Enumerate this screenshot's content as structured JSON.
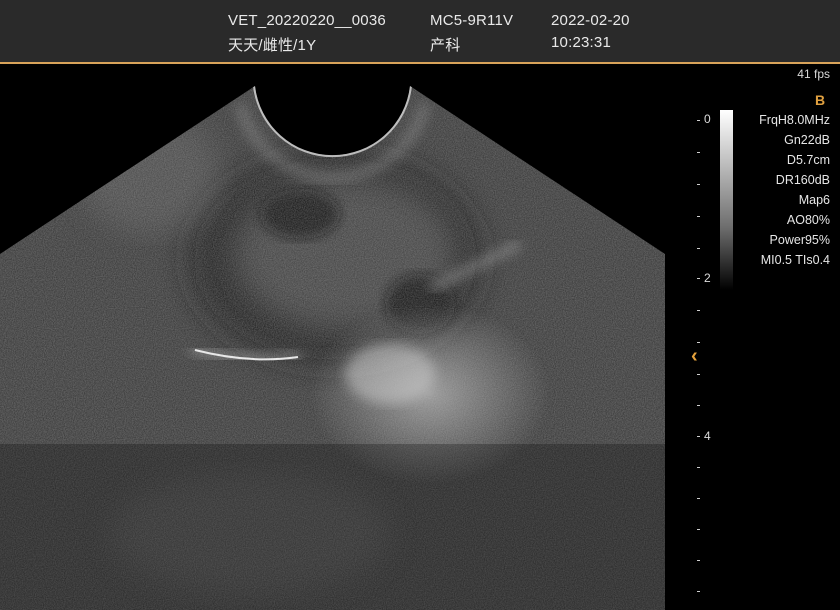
{
  "header": {
    "patient_id": "VET_20220220__0036",
    "patient_info": "天天/雌性/1Y",
    "probe": "MC5-9R11V",
    "department": "产科",
    "date": "2022-02-20",
    "time": "10:23:31"
  },
  "status": {
    "fps": "41 fps",
    "mode": "B"
  },
  "params": [
    "FrqH8.0MHz",
    "Gn22dB",
    "D5.7cm",
    "DR160dB",
    "Map6",
    "AO80%",
    "Power95%",
    "MI0.5 TIs0.4"
  ],
  "depth_scale": {
    "labels": [
      "0",
      "2",
      "4"
    ]
  },
  "colors": {
    "header_bg": "#2a2a2a",
    "accent": "#d8a35a",
    "focus_marker": "#e6a23c"
  },
  "icons": {
    "focus_marker": "chevron-left-icon"
  }
}
